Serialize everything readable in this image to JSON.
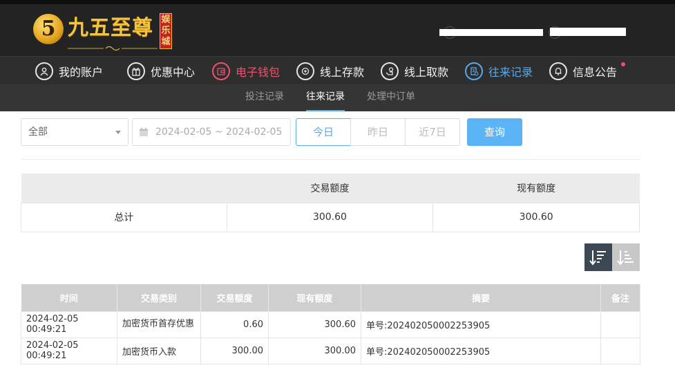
{
  "brand": {
    "logo_numeral": "5",
    "logo_text": "九五至尊",
    "logo_badge": "娱乐城"
  },
  "main_nav": [
    {
      "label": "我的账户",
      "icon": "user-icon"
    },
    {
      "label": "优惠中心",
      "icon": "gift-icon"
    },
    {
      "label": "电子钱包",
      "icon": "wallet-icon"
    },
    {
      "label": "线上存款",
      "icon": "deposit-icon"
    },
    {
      "label": "线上取款",
      "icon": "withdraw-icon"
    },
    {
      "label": "往来记录",
      "icon": "records-icon"
    },
    {
      "label": "信息公告",
      "icon": "bell-icon"
    }
  ],
  "sub_nav": [
    "投注记录",
    "往来记录",
    "处理中订单"
  ],
  "filter": {
    "type_select": "全部",
    "date_range": "2024-02-05 ~ 2024-02-05",
    "quick_dates": [
      "今日",
      "昨日",
      "近7日"
    ],
    "search_label": "查询"
  },
  "summary": {
    "headers": [
      "",
      "交易额度",
      "现有额度"
    ],
    "row_label": "总计",
    "transaction_amount": "300.60",
    "current_balance": "300.60"
  },
  "records": {
    "headers": [
      "时间",
      "交易类别",
      "交易额度",
      "现有额度",
      "摘要",
      "备注"
    ],
    "rows": [
      {
        "time": "2024-02-05 00:49:21",
        "type": "加密货币首存优惠",
        "amount": "0.60",
        "balance": "300.60",
        "summary": "单号:202402050002253905",
        "note": ""
      },
      {
        "time": "2024-02-05 00:49:21",
        "type": "加密货币入款",
        "amount": "300.00",
        "balance": "300.00",
        "summary": "单号:202402050002253905",
        "note": ""
      }
    ]
  },
  "colors": {
    "accent_blue": "#5aa9e6",
    "hot_pink": "#f0506e",
    "search_button": "#5ab4f5",
    "logo_gold": "#f3c43f"
  }
}
